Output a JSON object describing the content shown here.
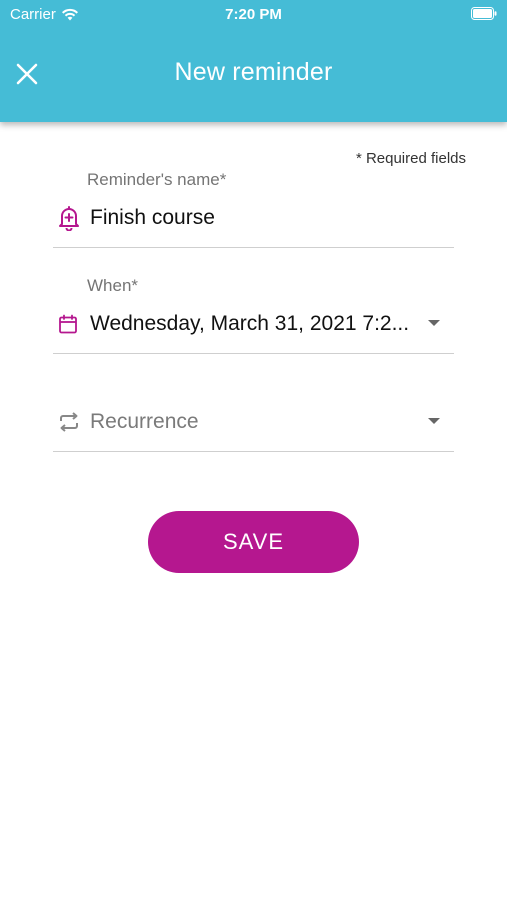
{
  "status_bar": {
    "carrier": "Carrier",
    "time": "7:20 PM"
  },
  "header": {
    "title": "New reminder",
    "close_icon": "close-icon",
    "background_color": "#45bcd6"
  },
  "form": {
    "required_note": "* Required fields",
    "name_field": {
      "label": "Reminder's name*",
      "value": "Finish course",
      "icon": "bell-plus-icon"
    },
    "when_field": {
      "label": "When*",
      "value": "Wednesday, March 31, 2021 7:2...",
      "icon": "calendar-icon"
    },
    "recurrence_field": {
      "placeholder": "Recurrence",
      "icon": "repeat-icon"
    }
  },
  "actions": {
    "save_label": "SAVE",
    "save_color": "#b5178f"
  },
  "colors": {
    "accent": "#b5178f",
    "header": "#45bcd6"
  }
}
